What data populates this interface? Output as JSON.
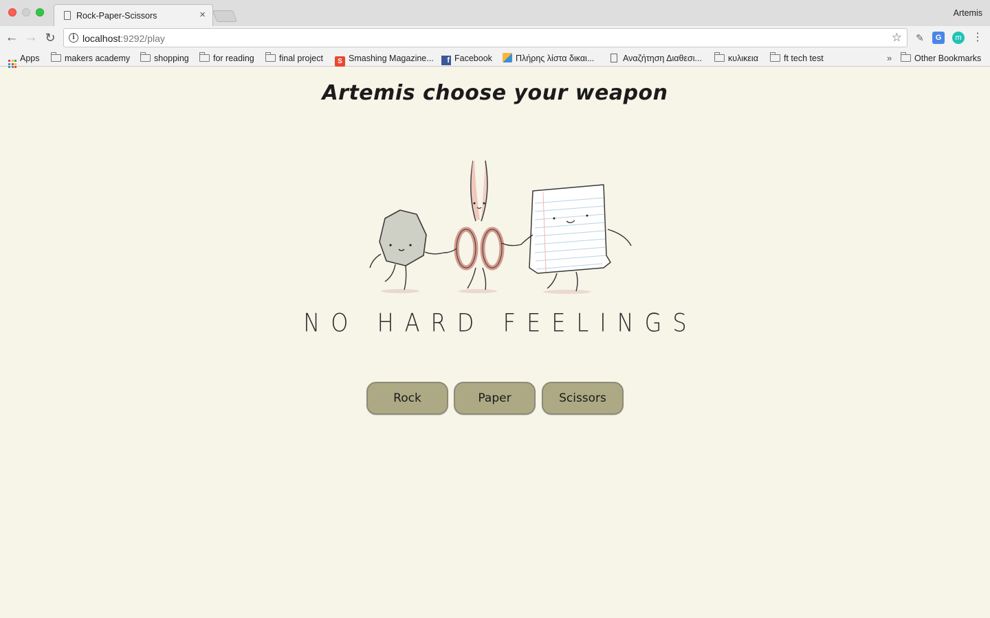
{
  "browser": {
    "tab_title": "Rock-Paper-Scissors",
    "profile_name": "Artemis",
    "url_host": "localhost",
    "url_path": ":9292/play"
  },
  "bookmarks": [
    {
      "label": "Apps",
      "icon": "apps-icon"
    },
    {
      "label": "makers academy",
      "icon": "folder-icon"
    },
    {
      "label": "shopping",
      "icon": "folder-icon"
    },
    {
      "label": "for reading",
      "icon": "folder-icon"
    },
    {
      "label": "final project",
      "icon": "folder-icon"
    },
    {
      "label": "Smashing Magazine...",
      "icon": "smashing-icon"
    },
    {
      "label": "Facebook",
      "icon": "facebook-icon"
    },
    {
      "label": "Πλήρης λίστα δικαι...",
      "icon": "cube-icon"
    },
    {
      "label": "Αναζήτηση Διαθεσι...",
      "icon": "page-icon"
    },
    {
      "label": "κυλικεια",
      "icon": "folder-icon"
    },
    {
      "label": "ft tech test",
      "icon": "folder-icon"
    }
  ],
  "other_bookmarks_label": "Other Bookmarks",
  "page": {
    "heading": "Artemis choose your weapon",
    "tagline": "NO HARD FEELINGS",
    "buttons": {
      "rock": "Rock",
      "paper": "Paper",
      "scissors": "Scissors"
    }
  },
  "colors": {
    "background": "#f7f4e8",
    "button": "#ada984",
    "button_border": "#8c8a78"
  }
}
